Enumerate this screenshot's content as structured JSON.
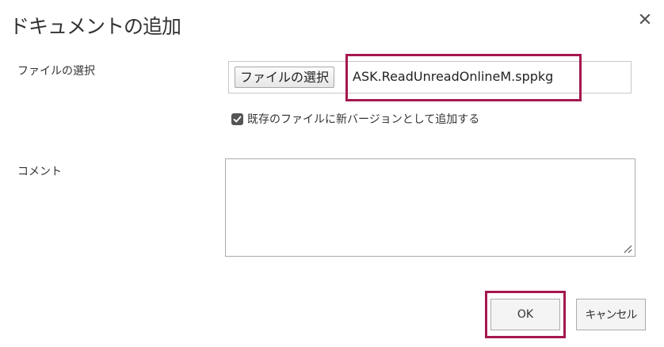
{
  "dialog": {
    "title": "ドキュメントの追加"
  },
  "file_field": {
    "label": "ファイルの選択",
    "button_label": "ファイルの選択",
    "file_name": "ASK.ReadUnreadOnlineM.sppkg"
  },
  "checkbox": {
    "checked": true,
    "label": "既存のファイルに新バージョンとして追加する"
  },
  "comment": {
    "label": "コメント",
    "value": ""
  },
  "actions": {
    "ok_label": "OK",
    "cancel_label": "キャンセル"
  },
  "colors": {
    "highlight": "#a4184f",
    "checkbox_fill": "#555555",
    "text": "#333333",
    "border": "#ababab"
  },
  "icons": {
    "close": "close-icon",
    "checkbox": "checkmark-icon",
    "resize": "resize-handle-icon"
  }
}
